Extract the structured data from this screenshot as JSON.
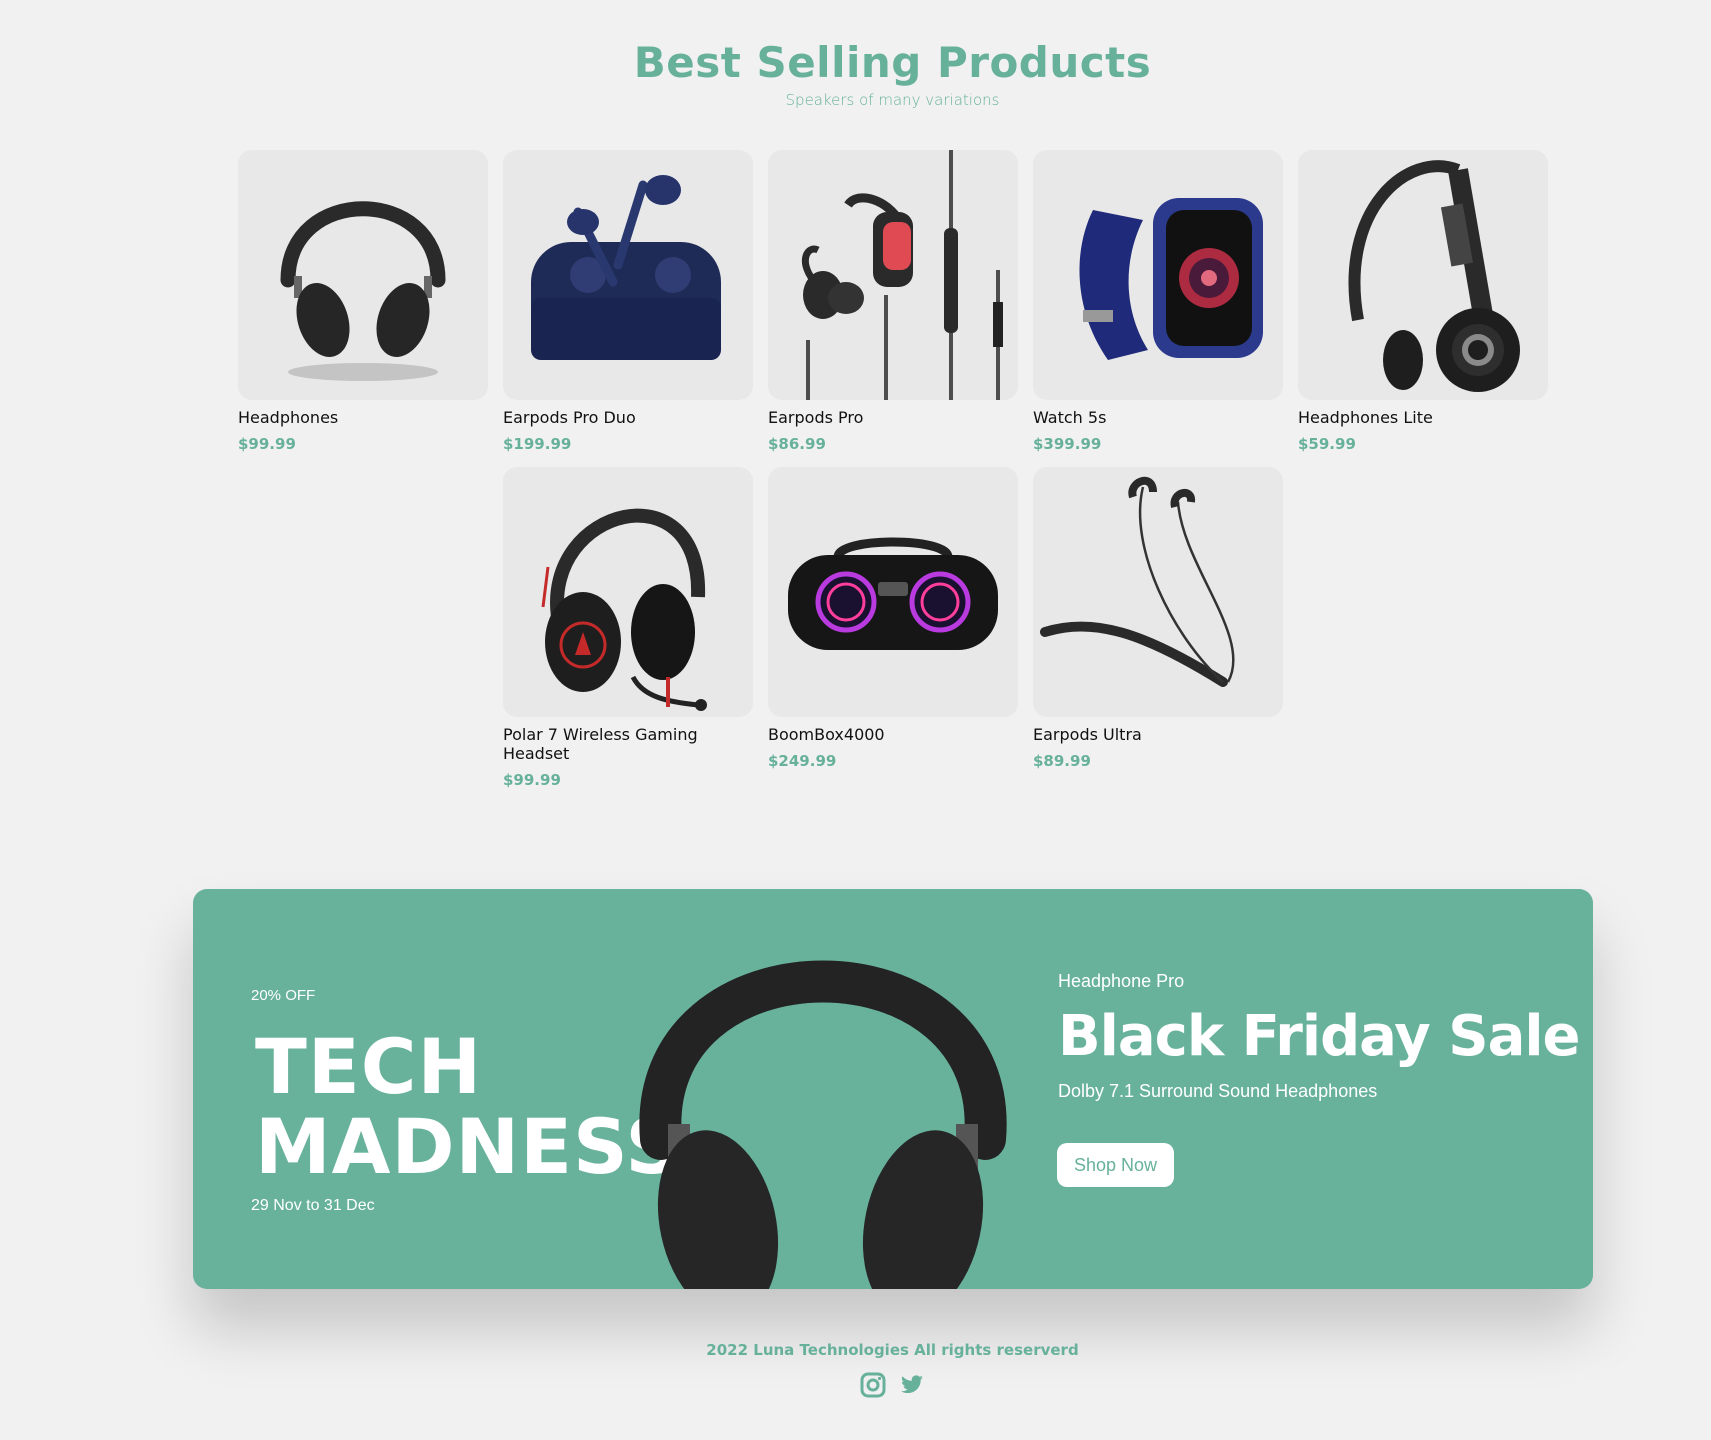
{
  "section": {
    "title": "Best Selling Products",
    "subtitle": "Speakers of many variations"
  },
  "products": [
    {
      "name": "Headphones",
      "price": "$99.99"
    },
    {
      "name": "Earpods Pro Duo",
      "price": "$199.99"
    },
    {
      "name": "Earpods Pro",
      "price": "$86.99"
    },
    {
      "name": "Watch 5s",
      "price": "$399.99"
    },
    {
      "name": "Headphones Lite",
      "price": "$59.99"
    },
    {
      "name": "Polar 7 Wireless Gaming Headset",
      "price": "$99.99"
    },
    {
      "name": "BoomBox4000",
      "price": "$249.99"
    },
    {
      "name": "Earpods Ultra",
      "price": "$89.99"
    }
  ],
  "banner": {
    "discount": "20% OFF",
    "title_line1": "TECH",
    "title_line2": "MADNESS",
    "dates": "29 Nov to 31 Dec",
    "product": "Headphone Pro",
    "headline": "Black Friday Sale",
    "description": "Dolby 7.1 Surround Sound Headphones",
    "button_label": "Shop Now"
  },
  "footer": {
    "copyright": "2022 Luna Technologies All rights reserverd",
    "social_icons": [
      "instagram-icon",
      "twitter-icon"
    ]
  },
  "colors": {
    "accent": "#67b19b",
    "background": "#f1f1f1",
    "card": "#e8e8e8"
  }
}
